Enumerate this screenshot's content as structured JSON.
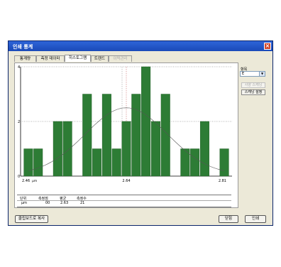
{
  "window": {
    "title": "인쇄 통계",
    "close_label": "×"
  },
  "tabs": [
    {
      "label": "통계량",
      "active": false,
      "disabled": false
    },
    {
      "label": "측정 데이터",
      "active": false,
      "disabled": false
    },
    {
      "label": "히스토그램",
      "active": true,
      "disabled": false
    },
    {
      "label": "트렌드",
      "active": false,
      "disabled": false
    },
    {
      "label": "이력관리",
      "active": false,
      "disabled": true
    }
  ],
  "side": {
    "label": "항목",
    "select_value": "E",
    "btn1": "사양 스캐닝",
    "btn2": "스캐닝 설정"
  },
  "chart_data": {
    "type": "bar",
    "x_ticks": [
      "2.46",
      "2.64",
      "2.81"
    ],
    "x_unit": "μm",
    "y_ticks": [
      "0",
      "2",
      "4"
    ],
    "ylim": [
      0,
      4
    ],
    "values": [
      1,
      1,
      0,
      2,
      2,
      0,
      3,
      1,
      3,
      1,
      2,
      3,
      4,
      2,
      3,
      0,
      1,
      1,
      2,
      0,
      1
    ],
    "series_color": "#2d7c35",
    "grid": true,
    "normal_curve": true
  },
  "table": {
    "headers": [
      "단위",
      "측정점",
      "평균",
      "측정수"
    ],
    "row": [
      "μm",
      "00",
      "2.63",
      "21"
    ]
  },
  "buttons": {
    "copy": "클립보드로 복사",
    "close": "닫힘",
    "print": "인쇄"
  }
}
